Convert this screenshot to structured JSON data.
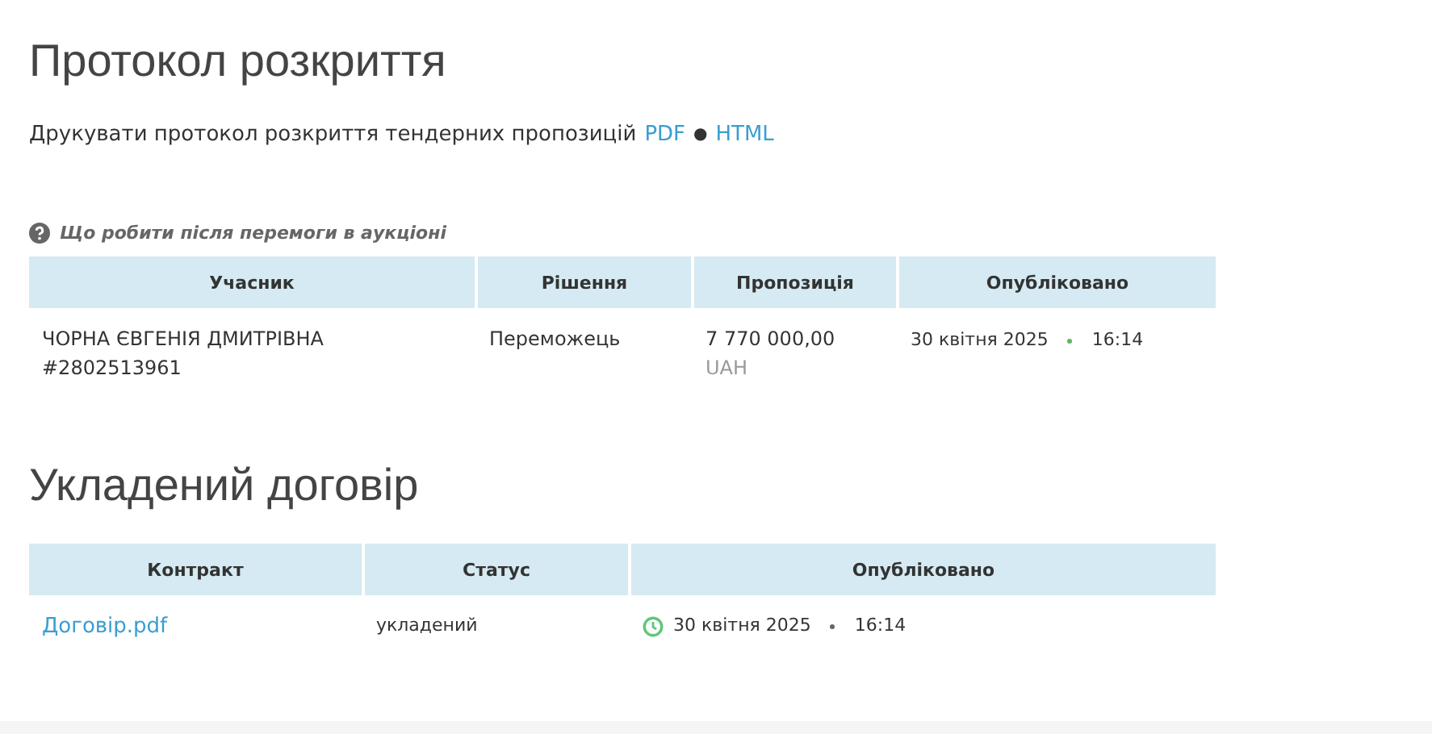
{
  "protocol": {
    "title": "Протокол розкриття",
    "print_text": "Друкувати протокол розкриття тендерних пропозицій",
    "links": [
      "PDF",
      "HTML"
    ],
    "separator": "●"
  },
  "help_link": "Що робити після перемоги в аукціоні",
  "bids_table": {
    "columns": [
      "Учасник",
      "Рішення",
      "Пропозиція",
      "Опубліковано"
    ],
    "rows": [
      {
        "participant": "ЧОРНА ЄВГЕНІЯ ДМИТРІВНА",
        "participant_id": "#2802513961",
        "decision": "Переможець",
        "amount": "7 770 000,00",
        "currency": "UAH",
        "date": "30 квітня 2025",
        "time": "16:14"
      }
    ]
  },
  "contract": {
    "title": "Укладений договір",
    "columns": [
      "Контракт",
      "Статус",
      "Опубліковано"
    ],
    "rows": [
      {
        "file": "Договір.pdf",
        "status": "укладений",
        "date": "30 квітня 2025",
        "time": "16:14"
      }
    ]
  }
}
